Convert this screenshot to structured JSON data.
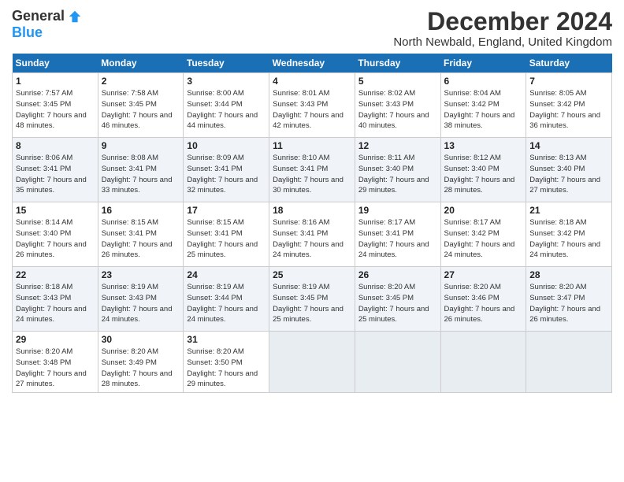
{
  "header": {
    "logo_general": "General",
    "logo_blue": "Blue",
    "title": "December 2024",
    "location": "North Newbald, England, United Kingdom"
  },
  "days_of_week": [
    "Sunday",
    "Monday",
    "Tuesday",
    "Wednesday",
    "Thursday",
    "Friday",
    "Saturday"
  ],
  "weeks": [
    [
      {
        "day": "1",
        "sunrise": "Sunrise: 7:57 AM",
        "sunset": "Sunset: 3:45 PM",
        "daylight": "Daylight: 7 hours and 48 minutes."
      },
      {
        "day": "2",
        "sunrise": "Sunrise: 7:58 AM",
        "sunset": "Sunset: 3:45 PM",
        "daylight": "Daylight: 7 hours and 46 minutes."
      },
      {
        "day": "3",
        "sunrise": "Sunrise: 8:00 AM",
        "sunset": "Sunset: 3:44 PM",
        "daylight": "Daylight: 7 hours and 44 minutes."
      },
      {
        "day": "4",
        "sunrise": "Sunrise: 8:01 AM",
        "sunset": "Sunset: 3:43 PM",
        "daylight": "Daylight: 7 hours and 42 minutes."
      },
      {
        "day": "5",
        "sunrise": "Sunrise: 8:02 AM",
        "sunset": "Sunset: 3:43 PM",
        "daylight": "Daylight: 7 hours and 40 minutes."
      },
      {
        "day": "6",
        "sunrise": "Sunrise: 8:04 AM",
        "sunset": "Sunset: 3:42 PM",
        "daylight": "Daylight: 7 hours and 38 minutes."
      },
      {
        "day": "7",
        "sunrise": "Sunrise: 8:05 AM",
        "sunset": "Sunset: 3:42 PM",
        "daylight": "Daylight: 7 hours and 36 minutes."
      }
    ],
    [
      {
        "day": "8",
        "sunrise": "Sunrise: 8:06 AM",
        "sunset": "Sunset: 3:41 PM",
        "daylight": "Daylight: 7 hours and 35 minutes."
      },
      {
        "day": "9",
        "sunrise": "Sunrise: 8:08 AM",
        "sunset": "Sunset: 3:41 PM",
        "daylight": "Daylight: 7 hours and 33 minutes."
      },
      {
        "day": "10",
        "sunrise": "Sunrise: 8:09 AM",
        "sunset": "Sunset: 3:41 PM",
        "daylight": "Daylight: 7 hours and 32 minutes."
      },
      {
        "day": "11",
        "sunrise": "Sunrise: 8:10 AM",
        "sunset": "Sunset: 3:41 PM",
        "daylight": "Daylight: 7 hours and 30 minutes."
      },
      {
        "day": "12",
        "sunrise": "Sunrise: 8:11 AM",
        "sunset": "Sunset: 3:40 PM",
        "daylight": "Daylight: 7 hours and 29 minutes."
      },
      {
        "day": "13",
        "sunrise": "Sunrise: 8:12 AM",
        "sunset": "Sunset: 3:40 PM",
        "daylight": "Daylight: 7 hours and 28 minutes."
      },
      {
        "day": "14",
        "sunrise": "Sunrise: 8:13 AM",
        "sunset": "Sunset: 3:40 PM",
        "daylight": "Daylight: 7 hours and 27 minutes."
      }
    ],
    [
      {
        "day": "15",
        "sunrise": "Sunrise: 8:14 AM",
        "sunset": "Sunset: 3:40 PM",
        "daylight": "Daylight: 7 hours and 26 minutes."
      },
      {
        "day": "16",
        "sunrise": "Sunrise: 8:15 AM",
        "sunset": "Sunset: 3:41 PM",
        "daylight": "Daylight: 7 hours and 26 minutes."
      },
      {
        "day": "17",
        "sunrise": "Sunrise: 8:15 AM",
        "sunset": "Sunset: 3:41 PM",
        "daylight": "Daylight: 7 hours and 25 minutes."
      },
      {
        "day": "18",
        "sunrise": "Sunrise: 8:16 AM",
        "sunset": "Sunset: 3:41 PM",
        "daylight": "Daylight: 7 hours and 24 minutes."
      },
      {
        "day": "19",
        "sunrise": "Sunrise: 8:17 AM",
        "sunset": "Sunset: 3:41 PM",
        "daylight": "Daylight: 7 hours and 24 minutes."
      },
      {
        "day": "20",
        "sunrise": "Sunrise: 8:17 AM",
        "sunset": "Sunset: 3:42 PM",
        "daylight": "Daylight: 7 hours and 24 minutes."
      },
      {
        "day": "21",
        "sunrise": "Sunrise: 8:18 AM",
        "sunset": "Sunset: 3:42 PM",
        "daylight": "Daylight: 7 hours and 24 minutes."
      }
    ],
    [
      {
        "day": "22",
        "sunrise": "Sunrise: 8:18 AM",
        "sunset": "Sunset: 3:43 PM",
        "daylight": "Daylight: 7 hours and 24 minutes."
      },
      {
        "day": "23",
        "sunrise": "Sunrise: 8:19 AM",
        "sunset": "Sunset: 3:43 PM",
        "daylight": "Daylight: 7 hours and 24 minutes."
      },
      {
        "day": "24",
        "sunrise": "Sunrise: 8:19 AM",
        "sunset": "Sunset: 3:44 PM",
        "daylight": "Daylight: 7 hours and 24 minutes."
      },
      {
        "day": "25",
        "sunrise": "Sunrise: 8:19 AM",
        "sunset": "Sunset: 3:45 PM",
        "daylight": "Daylight: 7 hours and 25 minutes."
      },
      {
        "day": "26",
        "sunrise": "Sunrise: 8:20 AM",
        "sunset": "Sunset: 3:45 PM",
        "daylight": "Daylight: 7 hours and 25 minutes."
      },
      {
        "day": "27",
        "sunrise": "Sunrise: 8:20 AM",
        "sunset": "Sunset: 3:46 PM",
        "daylight": "Daylight: 7 hours and 26 minutes."
      },
      {
        "day": "28",
        "sunrise": "Sunrise: 8:20 AM",
        "sunset": "Sunset: 3:47 PM",
        "daylight": "Daylight: 7 hours and 26 minutes."
      }
    ],
    [
      {
        "day": "29",
        "sunrise": "Sunrise: 8:20 AM",
        "sunset": "Sunset: 3:48 PM",
        "daylight": "Daylight: 7 hours and 27 minutes."
      },
      {
        "day": "30",
        "sunrise": "Sunrise: 8:20 AM",
        "sunset": "Sunset: 3:49 PM",
        "daylight": "Daylight: 7 hours and 28 minutes."
      },
      {
        "day": "31",
        "sunrise": "Sunrise: 8:20 AM",
        "sunset": "Sunset: 3:50 PM",
        "daylight": "Daylight: 7 hours and 29 minutes."
      },
      null,
      null,
      null,
      null
    ]
  ]
}
